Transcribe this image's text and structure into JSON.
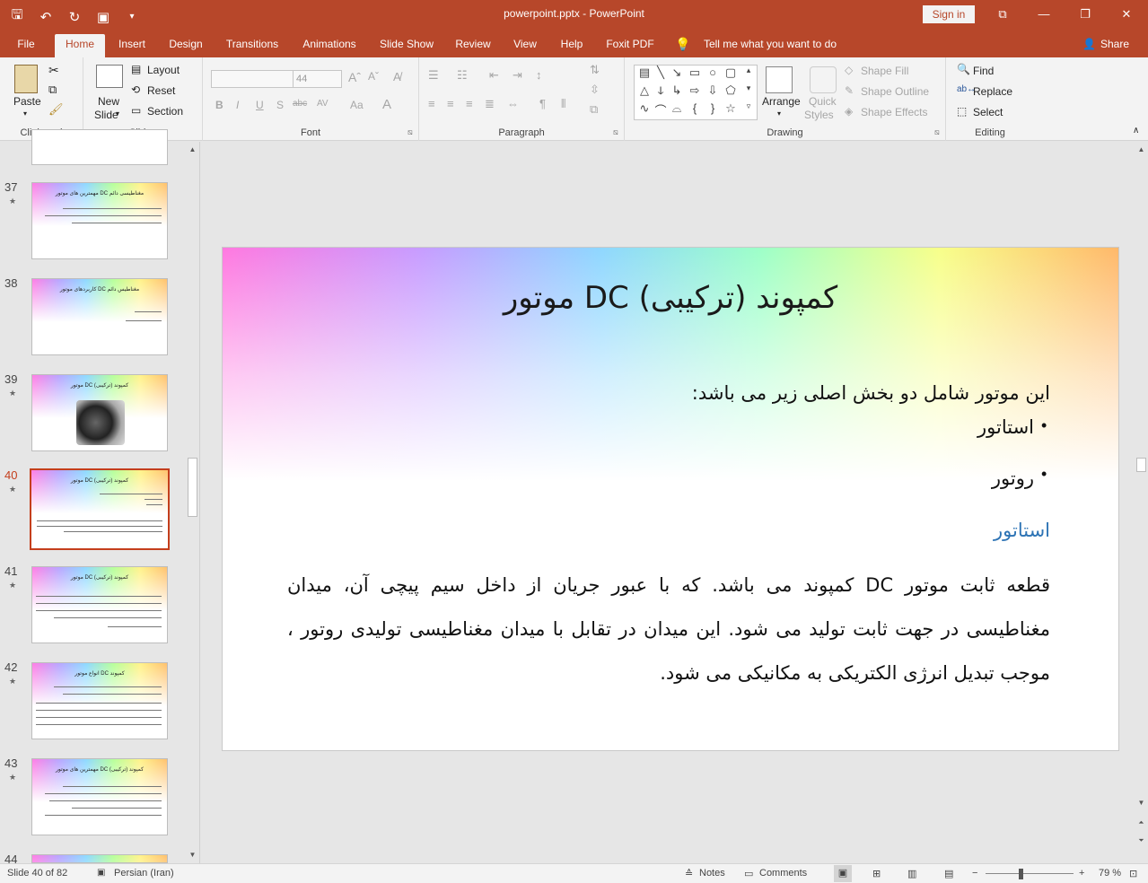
{
  "window": {
    "title": "powerpoint.pptx  -  PowerPoint",
    "signin": "Sign in",
    "controls": [
      "⧉",
      "—",
      "❐",
      "✕"
    ]
  },
  "tabs": [
    "File",
    "Home",
    "Insert",
    "Design",
    "Transitions",
    "Animations",
    "Slide Show",
    "Review",
    "View",
    "Help",
    "Foxit PDF",
    "Tell me what you want to do",
    "Share"
  ],
  "ribbon": {
    "clipboard": {
      "paste": "Paste",
      "label": "Clipboard"
    },
    "slides": {
      "new_slide_1": "New",
      "new_slide_2": "Slide",
      "layout": "Layout",
      "reset": "Reset",
      "section": "Section",
      "label": "Slides"
    },
    "font": {
      "size": "44",
      "bold": "B",
      "italic": "I",
      "underline": "U",
      "shadow": "S",
      "strike": "abc",
      "spacing": "AV",
      "case": "Aa",
      "color": "A",
      "label": "Font"
    },
    "paragraph": {
      "label": "Paragraph"
    },
    "drawing": {
      "arrange": "Arrange",
      "quick_1": "Quick",
      "quick_2": "Styles",
      "fill": "Shape Fill",
      "outline": "Shape Outline",
      "effects": "Shape Effects",
      "label": "Drawing"
    },
    "editing": {
      "find": "Find",
      "replace": "Replace",
      "select": "Select",
      "label": "Editing"
    }
  },
  "thumbnails": [
    {
      "num": "37",
      "title": "مهمترین های موتور DC مغناطیسی دائم",
      "selected": false
    },
    {
      "num": "38",
      "title": "کاربردهای موتور DC مغناطیس دائم",
      "selected": false
    },
    {
      "num": "39",
      "title": "موتور DC کمپوند (ترکیبی)",
      "selected": false
    },
    {
      "num": "40",
      "title": "موتور DC کمپوند (ترکیبی)",
      "selected": true
    },
    {
      "num": "41",
      "title": "موتور DC کمپوند (ترکیبی)",
      "selected": false
    },
    {
      "num": "42",
      "title": "انواع موتور DC کمپوند",
      "selected": false
    },
    {
      "num": "43",
      "title": "مهمترین های موتور DC کمپوند (ترکیبی)",
      "selected": false
    },
    {
      "num": "44",
      "title": "",
      "selected": false
    }
  ],
  "slide": {
    "title": "موتور DC کمپوند (ترکیبی)",
    "intro": "این موتور شامل دو بخش اصلی زیر می باشد:",
    "bullets": [
      "استاتور",
      "روتور"
    ],
    "subheading": "استاتور",
    "paragraph": "قطعه ثابت موتور DC کمپوند  می باشد. که با عبور جریان از داخل سیم پیچی آن، میدان مغناطیسی در جهت ثابت تولید می شود. این میدان در تقابل با میدان مغناطیسی تولیدی روتور ، موجب تبدیل انرژی الکتریکی به مکانیکی می شود."
  },
  "status": {
    "slide": "Slide 40 of 82",
    "language": "Persian (Iran)",
    "notes": "Notes",
    "comments": "Comments",
    "zoom": "79 %"
  },
  "colors": {
    "accent": "#b7472a",
    "subheading": "#2e74b5"
  }
}
